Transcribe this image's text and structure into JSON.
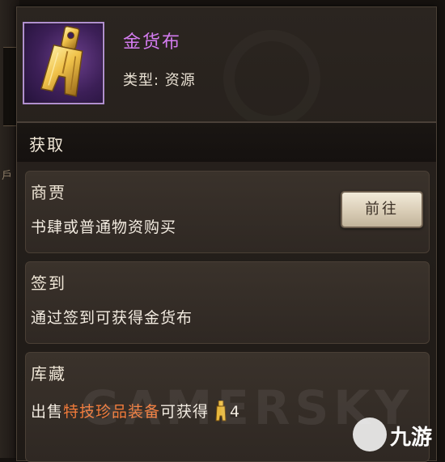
{
  "item": {
    "name": "金货布",
    "type_line": "类型: 资源",
    "icon": "spade-coin-icon"
  },
  "acquire": {
    "header": "获取",
    "sections": [
      {
        "title": "商贾",
        "description": "书肆或普通物资购买",
        "button_label": "前往"
      },
      {
        "title": "签到",
        "description": "通过签到可获得金货布"
      },
      {
        "title": "库藏",
        "desc_prefix": "出售",
        "desc_highlight": "特技珍品装备",
        "desc_suffix": "可获得",
        "reward_count": "4"
      }
    ]
  },
  "watermark": {
    "text": "GAMERSKY",
    "logo_text": "九游"
  },
  "colors": {
    "item_name": "#d47cf0",
    "highlight": "#f07a3a",
    "item_frame": "#b08fcf"
  }
}
